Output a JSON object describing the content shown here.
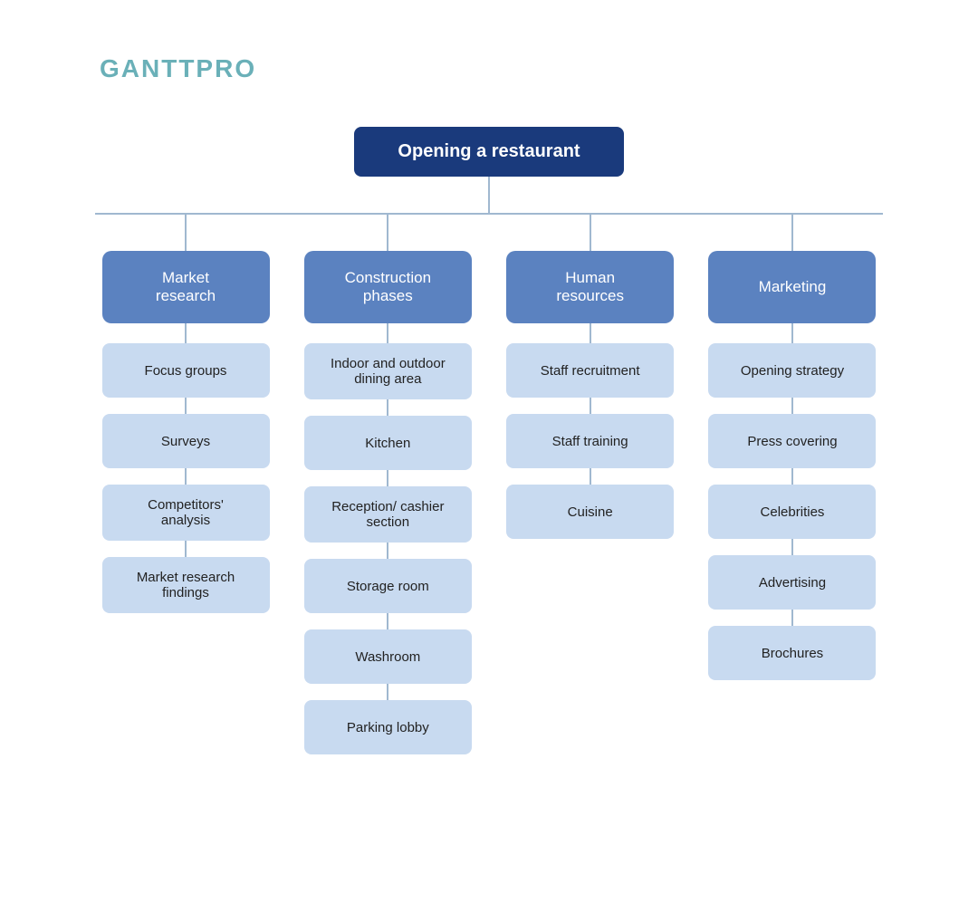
{
  "logo": "GANTTPRO",
  "root": "Opening a restaurant",
  "columns": [
    {
      "id": "market-research",
      "label": "Market\nresearch",
      "children": [
        "Focus groups",
        "Surveys",
        "Competitors'\nanalysis",
        "Market research\nfindings"
      ]
    },
    {
      "id": "construction-phases",
      "label": "Construction\nphases",
      "children": [
        "Indoor and outdoor\ndining area",
        "Kitchen",
        "Reception/ cashier\nsection",
        "Storage room",
        "Washroom",
        "Parking lobby"
      ]
    },
    {
      "id": "human-resources",
      "label": "Human\nresources",
      "children": [
        "Staff recruitment",
        "Staff training",
        "Cuisine"
      ]
    },
    {
      "id": "marketing",
      "label": "Marketing",
      "children": [
        "Opening strategy",
        "Press covering",
        "Celebrities",
        "Advertising",
        "Brochures"
      ]
    }
  ]
}
